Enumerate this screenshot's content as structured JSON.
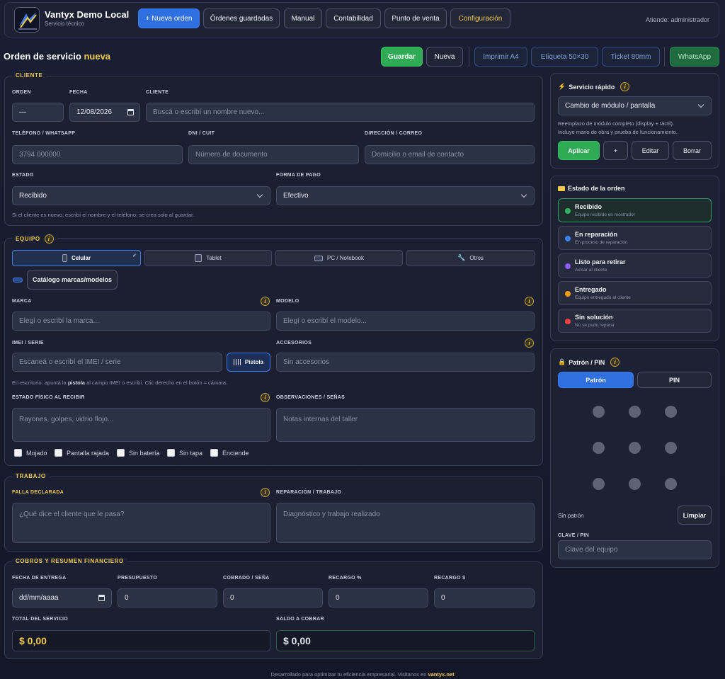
{
  "header": {
    "brand": "Vantyx Demo Local",
    "subtitle": "Servicio técnico",
    "nav": {
      "new_order": "+ Nueva orden",
      "saved_orders": "Órdenes guardadas",
      "manual": "Manual",
      "accounting": "Contabilidad",
      "pos": "Punto de venta",
      "config": "Configuración"
    },
    "attending": "Atiende: administrador"
  },
  "page": {
    "title": "Orden de servicio",
    "title_highlight": "nueva",
    "actions": {
      "save": "Guardar",
      "new": "Nueva",
      "print_a4": "Imprimir A4",
      "label": "Etiqueta 50×30",
      "ticket": "Ticket 80mm",
      "whatsapp": "WhatsApp"
    }
  },
  "cliente": {
    "section_title": "CLIENTE",
    "orden_label": "ORDEN",
    "orden_value": "—",
    "fecha_label": "FECHA",
    "fecha_value": "12/08/2026",
    "cliente_label": "CLIENTE",
    "cliente_placeholder": "Buscá o escribí un nombre nuevo...",
    "telefono_label": "TELÉFONO / WHATSAPP",
    "telefono_placeholder": "3794 000000",
    "dni_label": "DNI / CUIT",
    "dni_placeholder": "Número de documento",
    "direccion_label": "DIRECCIÓN / CORREO",
    "direccion_placeholder": "Domicilio o email de contacto",
    "estado_label": "ESTADO",
    "estado_value": "Recibido",
    "pago_label": "FORMA DE PAGO",
    "pago_value": "Efectivo",
    "hint": "Si el cliente es nuevo, escribí el nombre y el teléfono: se crea solo al guardar."
  },
  "equipo": {
    "section_title": "EQUIPO",
    "tabs": [
      "Celular",
      "Tablet",
      "PC / Notebook",
      "Otros"
    ],
    "tab_check": "✓",
    "catalog_button": "Catálogo marcas/modelos",
    "marca_label": "MARCA",
    "marca_placeholder": "Elegí o escribí la marca...",
    "modelo_label": "MODELO",
    "modelo_placeholder": "Elegí o escribí el modelo...",
    "imei_label": "IMEI / SERIE",
    "imei_placeholder": "Escaneá o escribí el IMEI / serie",
    "pistola_button": "Pistola",
    "accesorios_label": "ACCESORIOS",
    "accesorios_placeholder": "Sin accesorios",
    "hint_pre": "En escritorio: apuntá la",
    "hint_bold": "pistola",
    "hint_post": "al campo IMEI o escribí. Clic derecho en el botón = cámara.",
    "estado_fisico_label": "ESTADO FÍSICO AL RECIBIR",
    "estado_fisico_placeholder": "Rayones, golpes, vidrio flojo...",
    "observaciones_label": "OBSERVACIONES / SEÑAS",
    "observaciones_placeholder": "Notas internas del taller",
    "checks": [
      "Mojado",
      "Pantalla rajada",
      "Sin batería",
      "Sin tapa",
      "Enciende"
    ]
  },
  "trabajo": {
    "section_title": "TRABAJO",
    "falla_label": "FALLA DECLARADA",
    "falla_placeholder": "¿Qué dice el cliente que le pasa?",
    "reparacion_label": "REPARACIÓN / TRABAJO",
    "reparacion_placeholder": "Diagnóstico y trabajo realizado"
  },
  "cobros": {
    "section_title": "COBROS Y RESUMEN FINANCIERO",
    "entrega_label": "FECHA DE ENTREGA",
    "entrega_value": "dd/mm/aaaa",
    "presupuesto_label": "PRESUPUESTO",
    "presupuesto_value": "0",
    "cobrado_label": "COBRADO / SEÑA",
    "cobrado_value": "0",
    "recargo_pct_label": "RECARGO %",
    "recargo_pct_value": "0",
    "recargo_abs_label": "RECARGO $",
    "recargo_abs_value": "0",
    "total_label": "TOTAL DEL SERVICIO",
    "total_value": "$ 0,00",
    "saldo_label": "SALDO A COBRAR",
    "saldo_value": "$ 0,00"
  },
  "rapido": {
    "title": "Servicio rápido",
    "select_value": "Cambio de módulo / pantalla",
    "desc1": "Reemplazo de módulo completo (display + táctil).",
    "desc2": "Incluye mano de obra y prueba de funcionamiento.",
    "apply": "Aplicar",
    "add": "+",
    "edit": "Editar",
    "delete": "Borrar"
  },
  "estado_orden": {
    "title": "Estado de la orden",
    "states": [
      {
        "title": "Recibido",
        "sub": "Equipo recibido en mostrador",
        "color": "#2fb560"
      },
      {
        "title": "En reparación",
        "sub": "En proceso de reparación",
        "color": "#3b82f6"
      },
      {
        "title": "Listo para retirar",
        "sub": "Avisar al cliente",
        "color": "#8b5cf6"
      },
      {
        "title": "Entregado",
        "sub": "Equipo entregado al cliente",
        "color": "#f59e0b"
      },
      {
        "title": "Sin solución",
        "sub": "No se pudo reparar",
        "color": "#ef4444"
      }
    ]
  },
  "patron": {
    "title": "Patrón / PIN",
    "tab_pattern": "Patrón",
    "tab_pin": "PIN",
    "status": "Sin patrón",
    "clear": "Limpiar",
    "clave_label": "CLAVE / PIN",
    "clave_placeholder": "Clave del equipo"
  },
  "footer": {
    "text": "Desarrollado para optimizar tu eficiencia empresarial. Visitanos en",
    "link": "vantyx.net"
  },
  "colors": {
    "accent_blue": "#2f6fe0",
    "accent_green": "#2faa55",
    "accent_gold": "#f2c94c"
  }
}
